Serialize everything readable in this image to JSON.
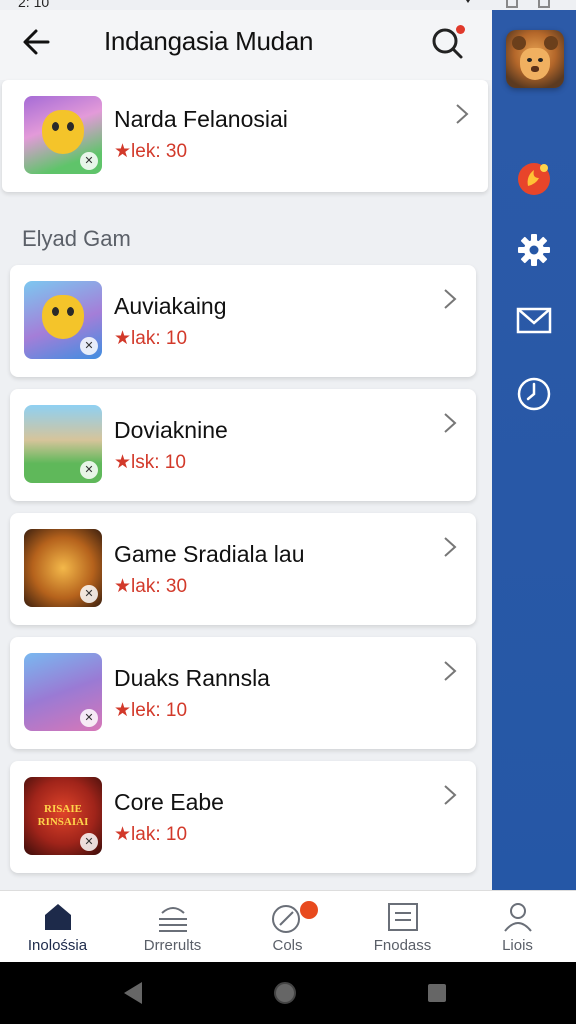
{
  "status": {
    "time": "2: 10"
  },
  "header": {
    "title": "Indangasia Mudan",
    "back_icon": "arrow-left-icon",
    "search_icon": "search-icon"
  },
  "featured": {
    "title": "Narda Felanosiai",
    "meta": "★lek: 30"
  },
  "section": {
    "label": "Elyad Gam"
  },
  "games": [
    {
      "title": "Auviakaing",
      "meta": "★lak: 10"
    },
    {
      "title": "Doviaknine",
      "meta": "★lsk: 10"
    },
    {
      "title": "Game Sradiala lau",
      "meta": "★lak: 30"
    },
    {
      "title": "Duaks Rannsla",
      "meta": "★lek: 10"
    },
    {
      "title": "Core Eabe",
      "meta": "★lak: 10",
      "thumb_text": "RISAIE RINSAIAI"
    }
  ],
  "rail": {
    "icons": [
      "lion-avatar-icon",
      "flame-badge-icon",
      "gear-icon",
      "mail-icon",
      "clock-icon"
    ]
  },
  "nav": {
    "items": [
      {
        "label": "Inolośsia",
        "icon": "home-icon"
      },
      {
        "label": "Drrerults",
        "icon": "scale-icon"
      },
      {
        "label": "Cols",
        "icon": "compass-icon"
      },
      {
        "label": "Fnodass",
        "icon": "list-icon"
      },
      {
        "label": "Liois",
        "icon": "person-icon"
      }
    ]
  },
  "colors": {
    "accent": "#d2392a",
    "rail": "#2557a6",
    "background": "#eef0f3"
  }
}
